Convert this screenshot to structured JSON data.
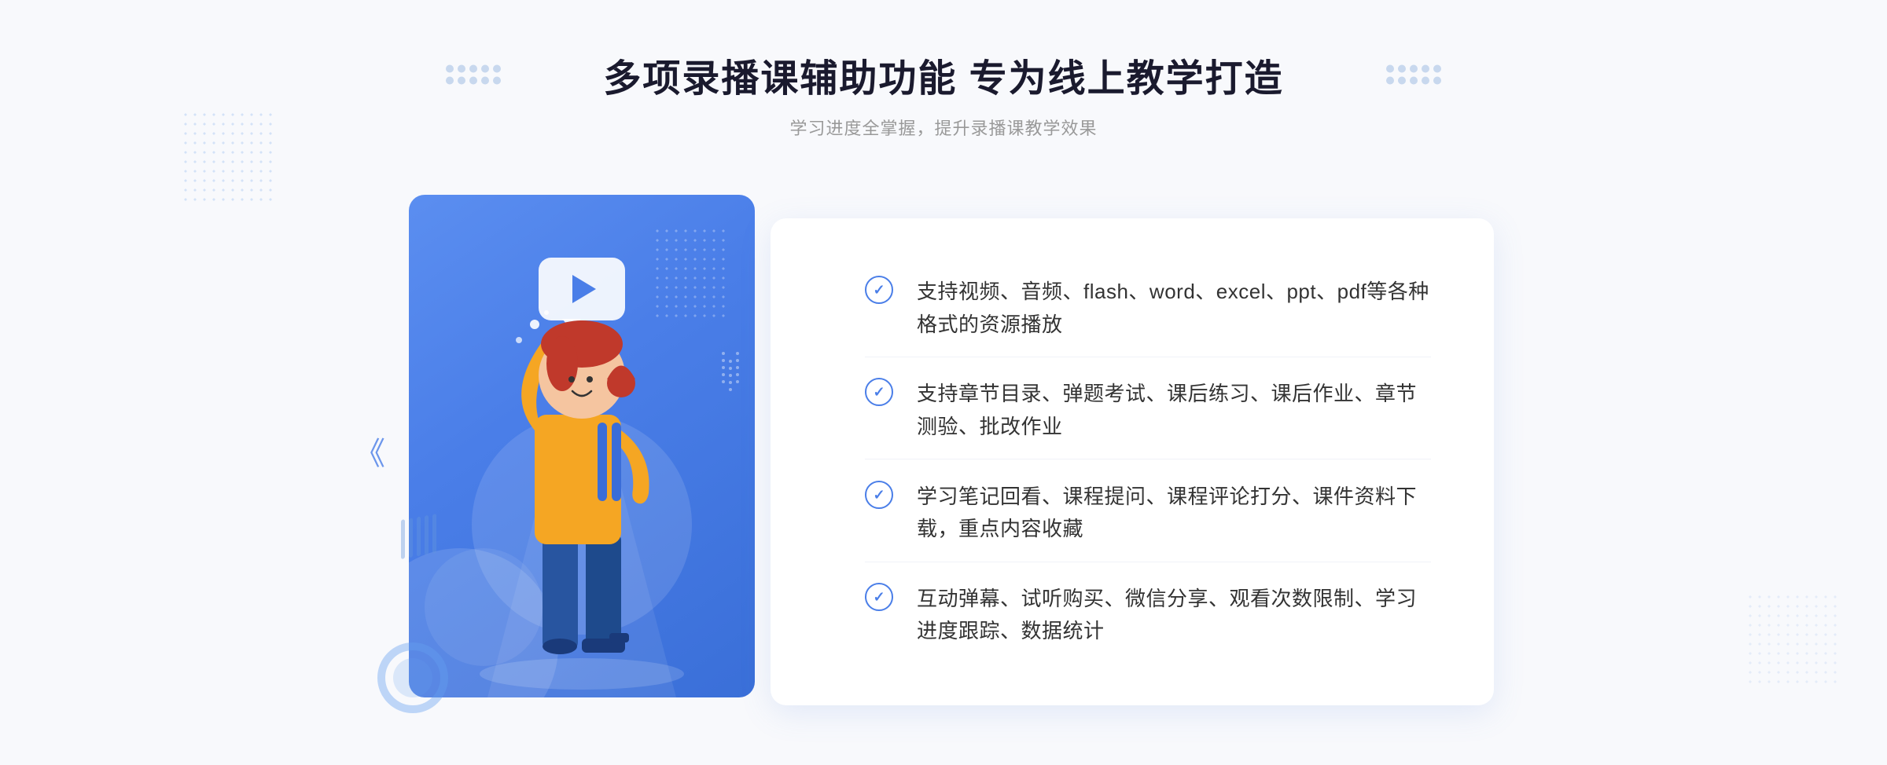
{
  "page": {
    "background_color": "#f4f7fc"
  },
  "header": {
    "title": "多项录播课辅助功能 专为线上教学打造",
    "subtitle": "学习进度全掌握，提升录播课教学效果"
  },
  "features": [
    {
      "id": 1,
      "text": "支持视频、音频、flash、word、excel、ppt、pdf等各种格式的资源播放"
    },
    {
      "id": 2,
      "text": "支持章节目录、弹题考试、课后练习、课后作业、章节测验、批改作业"
    },
    {
      "id": 3,
      "text": "学习笔记回看、课程提问、课程评论打分、课件资料下载，重点内容收藏"
    },
    {
      "id": 4,
      "text": "互动弹幕、试听购买、微信分享、观看次数限制、学习进度跟踪、数据统计"
    }
  ],
  "icons": {
    "play": "▶",
    "check": "✓",
    "chevron_left": "《"
  },
  "colors": {
    "primary_blue": "#4a7ee8",
    "light_blue": "#5b8ef0",
    "text_dark": "#333333",
    "text_gray": "#999999",
    "border_light": "#f0f2f8"
  }
}
